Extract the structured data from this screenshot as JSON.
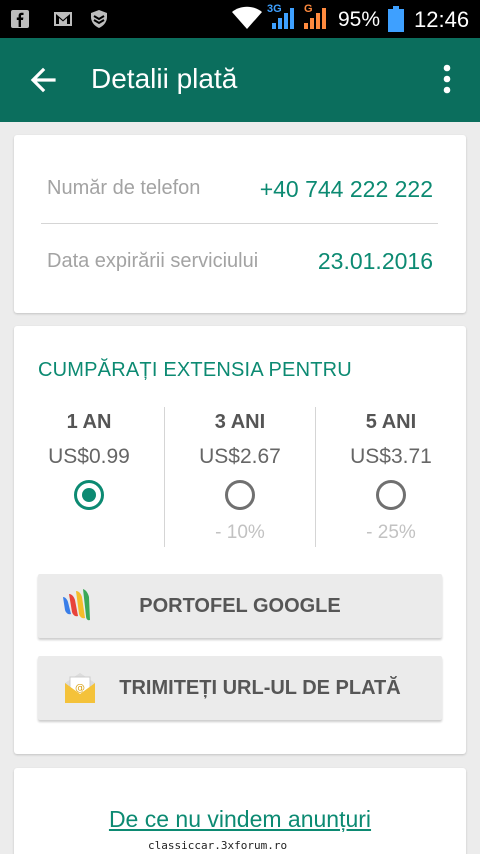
{
  "status_bar": {
    "network_label": "3G",
    "signal2_label": "G",
    "battery_pct": "95%",
    "time": "12:46",
    "icons": [
      "facebook-icon",
      "gmail-icon",
      "shield-app-icon",
      "wifi-icon",
      "signal-icon",
      "signal-icon",
      "battery-icon"
    ]
  },
  "toolbar": {
    "title": "Detalii plată",
    "back_icon": "arrow-left-icon",
    "more_icon": "more-vert-icon",
    "color": "#0b6e5d"
  },
  "details": {
    "phone_label": "Număr de telefon",
    "phone_value": "+40 744 222 222",
    "expiry_label": "Data expirării serviciului",
    "expiry_value": "23.01.2016"
  },
  "extension": {
    "title": "CUMPĂRAȚI EXTENSIA PENTRU",
    "plans": [
      {
        "name": "1 AN",
        "price": "US$0.99",
        "discount": "",
        "selected": true
      },
      {
        "name": "3 ANI",
        "price": "US$2.67",
        "discount": "- 10%",
        "selected": false
      },
      {
        "name": "5 ANI",
        "price": "US$3.71",
        "discount": "- 25%",
        "selected": false
      }
    ],
    "google_wallet_label": "PORTOFEL GOOGLE",
    "send_url_label": "TRIMITEȚI URL-UL DE PLATĂ"
  },
  "footer": {
    "link_text": "De ce nu vindem anunțuri"
  },
  "watermark": "classiccar.3xforum.ro",
  "accent_color": "#0c8a72"
}
